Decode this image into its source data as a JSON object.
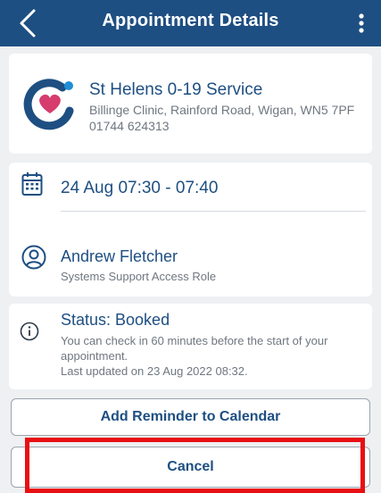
{
  "header": {
    "title": "Appointment Details",
    "back_icon": "chevron-left-icon",
    "more_icon": "vertical-ellipsis-icon"
  },
  "clinic": {
    "name": "St Helens 0-19 Service",
    "address": "Billinge Clinic, Rainford Road, Wigan, WN5 7PF",
    "phone": "01744 624313",
    "logo_icon": "heart-c-logo-icon"
  },
  "appointment": {
    "time": "24 Aug 07:30 - 07:40",
    "calendar_icon": "calendar-icon",
    "person_name": "Andrew Fletcher",
    "person_role": "Systems Support Access Role",
    "person_icon": "user-circle-icon"
  },
  "status": {
    "title": "Status: Booked",
    "line1": "You can check in 60 minutes before the start of your appointment.",
    "line2": "Last updated on 23 Aug 2022 08:32.",
    "info_icon": "info-icon"
  },
  "buttons": {
    "add_reminder": "Add Reminder to Calendar",
    "cancel": "Cancel"
  },
  "colors": {
    "header_bg": "#1e4f82",
    "accent_text": "#1e4f82",
    "highlight": "#e80f12",
    "logo_heart": "#d63c6e"
  }
}
